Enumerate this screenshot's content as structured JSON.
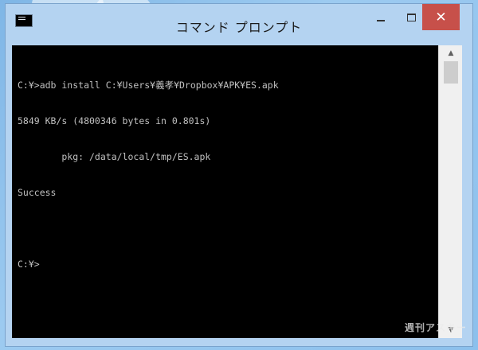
{
  "window": {
    "title": "コマンド プロンプト",
    "close_symbol": "✕"
  },
  "console": {
    "lines": [
      "C:¥>adb install C:¥Users¥義孝¥Dropbox¥APK¥ES.apk",
      "5849 KB/s (4800346 bytes in 0.801s)",
      "        pkg: /data/local/tmp/ES.apk",
      "Success",
      "",
      "C:¥>"
    ]
  },
  "scrollbar": {
    "up_arrow": "▲",
    "down_arrow": "▼"
  },
  "watermark": "週刊アスキー",
  "icons": {
    "app": "command-prompt-icon",
    "minimize": "minimize-icon",
    "maximize": "maximize-icon",
    "close": "close-icon"
  }
}
